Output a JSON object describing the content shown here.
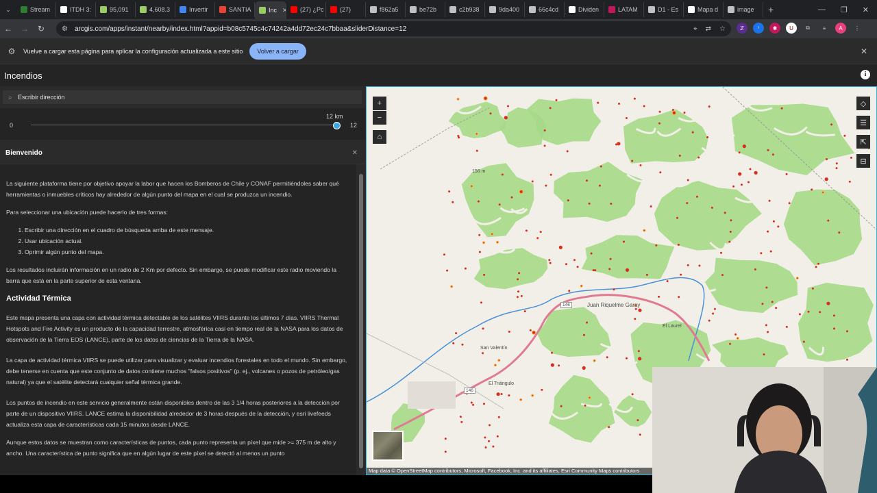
{
  "browser": {
    "tabs": [
      {
        "label": "Stream",
        "color": "#2e7d32"
      },
      {
        "label": "ITDH 3:",
        "color": "#ffffff"
      },
      {
        "label": "95,091",
        "color": "#9ccc65"
      },
      {
        "label": "4,608.3",
        "color": "#9ccc65"
      },
      {
        "label": "Invertir",
        "color": "#4285f4"
      },
      {
        "label": "SANTIA",
        "color": "#ea4335"
      },
      {
        "label": "Inc",
        "color": "#9ccc65",
        "active": true
      },
      {
        "label": "(27) ¿Pc",
        "color": "#ff0000"
      },
      {
        "label": "(27)",
        "color": "#ff0000"
      },
      {
        "label": "f862a5",
        "color": "#bdc1c6"
      },
      {
        "label": "be72b",
        "color": "#bdc1c6"
      },
      {
        "label": "c2b938",
        "color": "#bdc1c6"
      },
      {
        "label": "9da400",
        "color": "#bdc1c6"
      },
      {
        "label": "66c4cd",
        "color": "#bdc1c6"
      },
      {
        "label": "Dividen",
        "color": "#ffffff"
      },
      {
        "label": "LATAM",
        "color": "#c2185b"
      },
      {
        "label": "D1 - Es",
        "color": "#bdc1c6"
      },
      {
        "label": "Mapa d",
        "color": "#ffffff"
      },
      {
        "label": "image",
        "color": "#bdc1c6"
      }
    ],
    "url": "arcgis.com/apps/instant/nearby/index.html?appid=b08c5745c4c74242a4dd72ec24c7bbaa&sliderDistance=12",
    "infobar_text": "Vuelve a cargar esta página para aplicar la configuración actualizada a este sitio",
    "infobar_button": "Volver a cargar",
    "profile_initial": "A"
  },
  "app": {
    "title": "Incendios",
    "search_placeholder": "Escribir dirección",
    "slider": {
      "min": "0",
      "max": "12",
      "current_label": "12 km",
      "value_fraction": 1.0
    },
    "panel_title": "Bienvenido",
    "content": {
      "p1": "La siguiente plataforma tiene por objetivo apoyar la labor que hacen los Bomberos de Chile y CONAF permitiéndoles saber qué herramientas o inmuebles críticos hay alrededor de algún punto del mapa en el cual se produzca un incendio.",
      "p2": "Para seleccionar una ubicación puede hacerlo de tres formas:",
      "list": [
        "Escribir una dirección en el cuadro de búsqueda arriba de este mensaje.",
        "Usar ubicación actual.",
        "Oprimir algún punto del mapa."
      ],
      "p3": "Los resultados incluirán información en un radio de 2 Km por defecto. Sin embargo, se puede modificar este radio moviendo la barra que está en la parte superior de esta ventana.",
      "h_thermal": "Actividad Térmica",
      "p4": "Este mapa presenta una capa con actividad térmica detectable de los satélites VIIRS durante los últimos 7 días. VIIRS Thermal Hotspots and Fire Activity es un producto de la capacidad terrestre, atmosférica casi en tiempo real de la NASA para los datos de observación de la Tierra EOS (LANCE), parte de los datos de ciencias de la Tierra de la NASA.",
      "p5": "La capa de actividad térmica VIIRS se puede utilizar para visualizar y evaluar incendios forestales en todo el mundo. Sin embargo, debe tenerse en cuenta que este conjunto de datos contiene muchos \"falsos positivos\" (p. ej., volcanes o pozos de petróleo/gas natural) ya que el satélite detectará cualquier señal térmica grande.",
      "p6": "Los puntos de incendio en este servicio generalmente están disponibles dentro de las 3 1/4 horas posteriores a la detección por parte de un dispositivo VIIRS. LANCE estima la disponibilidad alrededor de 3 horas después de la detección, y esri livefeeds actualiza esta capa de características cada 15 minutos desde LANCE.",
      "p7": "Aunque estos datos se muestran como características de puntos, cada punto representa un píxel que mide >= 375 m de alto y ancho. Una característica de punto significa que en algún lugar de este píxel se detectó al menos un punto"
    }
  },
  "map": {
    "labels": {
      "juan": "Juan Riquelme Garay",
      "sanvalentin": "San Valentín",
      "laurel": "El Laurel",
      "triangulo": "El Triángulo",
      "r146a": "146",
      "r146b": "146",
      "alt": "156 m"
    },
    "attribution": "Map data © OpenStreetMap contributors, Microsoft, Facebook, Inc. and its affiliates, Esri Community Maps contributors",
    "colors": {
      "forest": "#a6d987",
      "land": "#f2efe9",
      "road": "#e07a93",
      "river": "#4a90d9",
      "hotspot": "#d62f1f"
    }
  }
}
